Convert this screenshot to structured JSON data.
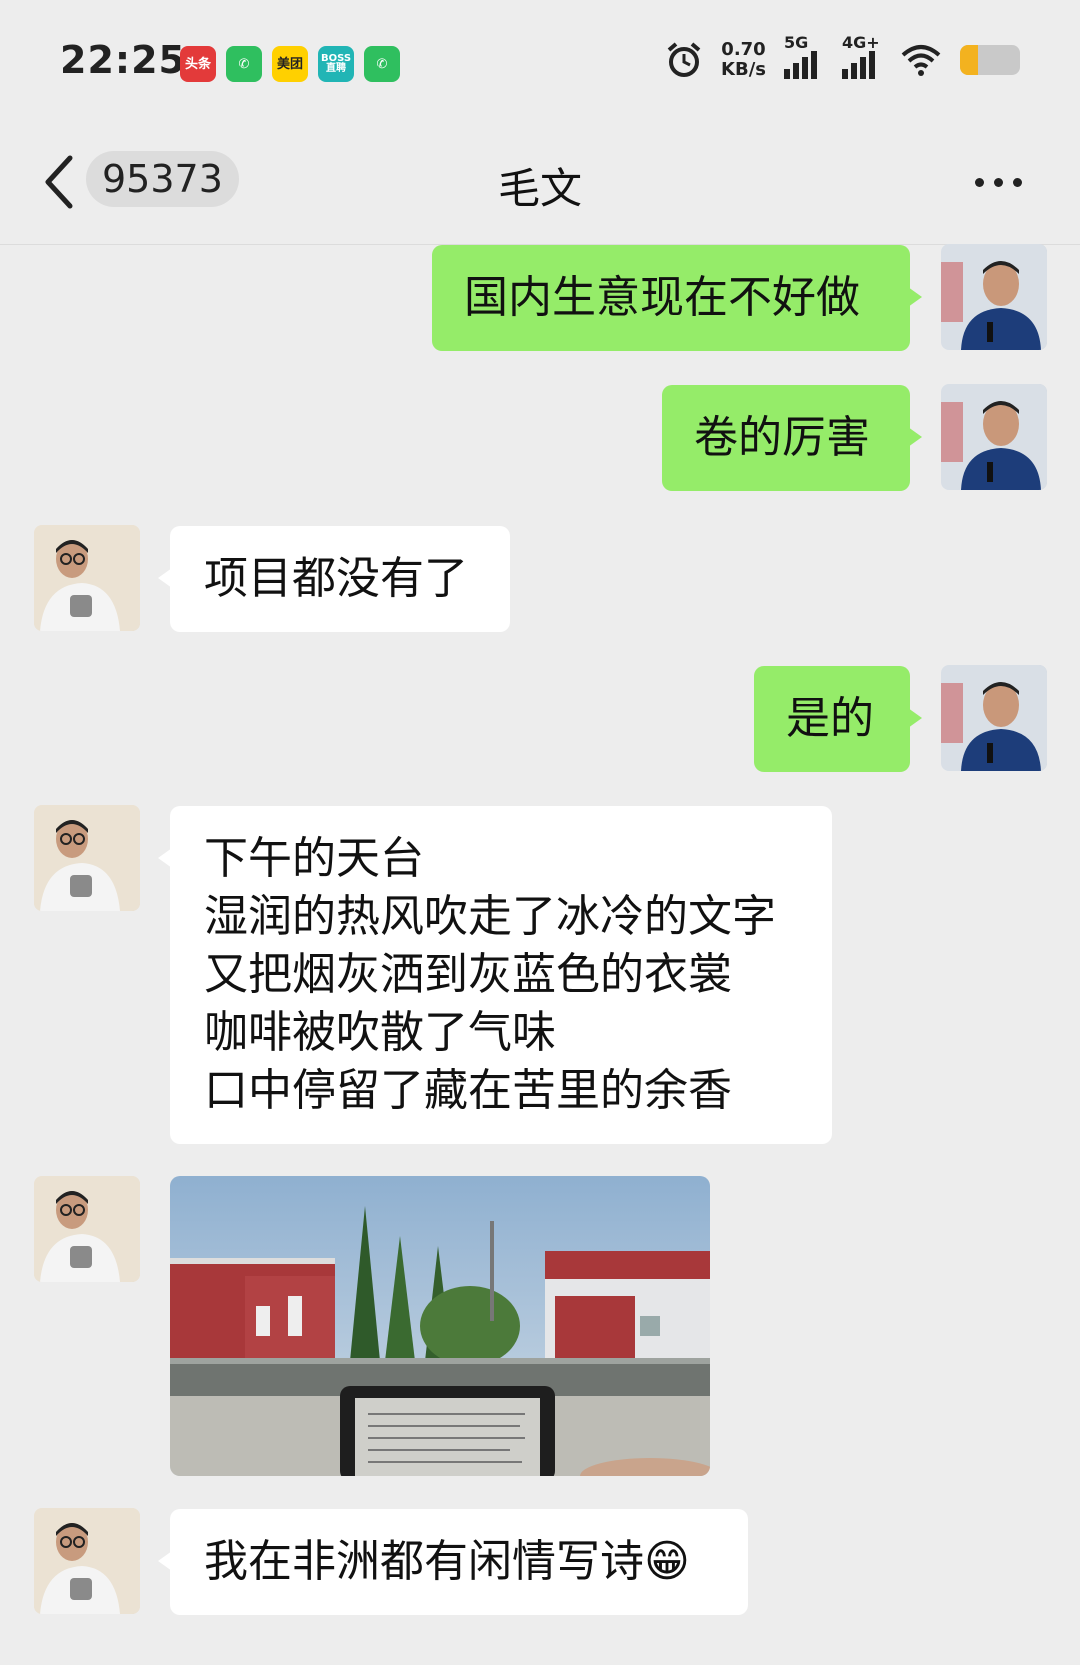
{
  "status_bar": {
    "time": "22:25",
    "app_icons": [
      {
        "name": "toutiao-icon",
        "label": "头条",
        "color": "#e33a3a"
      },
      {
        "name": "phone-app-icon",
        "label": "",
        "color": "#2fbf5f"
      },
      {
        "name": "meituan-icon",
        "label": "美团",
        "color": "#ffd000"
      },
      {
        "name": "boss-zhipin-icon",
        "label": "BOSS直聘",
        "color": "#21b5b5"
      },
      {
        "name": "phone-app-icon-2",
        "label": "",
        "color": "#2fbf5f"
      }
    ],
    "net_speed_value": "0.70",
    "net_speed_unit": "KB/s",
    "signal_1_label": "5G",
    "signal_2_label": "4G+",
    "battery_level": 0.3
  },
  "header": {
    "unread_count": "95373",
    "title": "毛文"
  },
  "messages": [
    {
      "sender": "me",
      "type": "text",
      "text": "国内生意现在不好做"
    },
    {
      "sender": "me",
      "type": "text",
      "text": "卷的厉害"
    },
    {
      "sender": "friend",
      "type": "text",
      "text": "项目都没有了"
    },
    {
      "sender": "me",
      "type": "text",
      "text": "是的"
    },
    {
      "sender": "friend",
      "type": "text",
      "text": "下午的天台\n湿润的热风吹走了冰冷的文字\n又把烟灰洒到灰蓝色的衣裳\n咖啡被吹散了气味\n口中停留了藏在苦里的余香"
    },
    {
      "sender": "friend",
      "type": "image",
      "description": "rooftop-photo"
    },
    {
      "sender": "friend",
      "type": "text",
      "text": "我在非洲都有闲情写诗😁"
    }
  ],
  "colors": {
    "background": "#ededed",
    "my_bubble": "#95ec69",
    "friend_bubble": "#ffffff"
  }
}
